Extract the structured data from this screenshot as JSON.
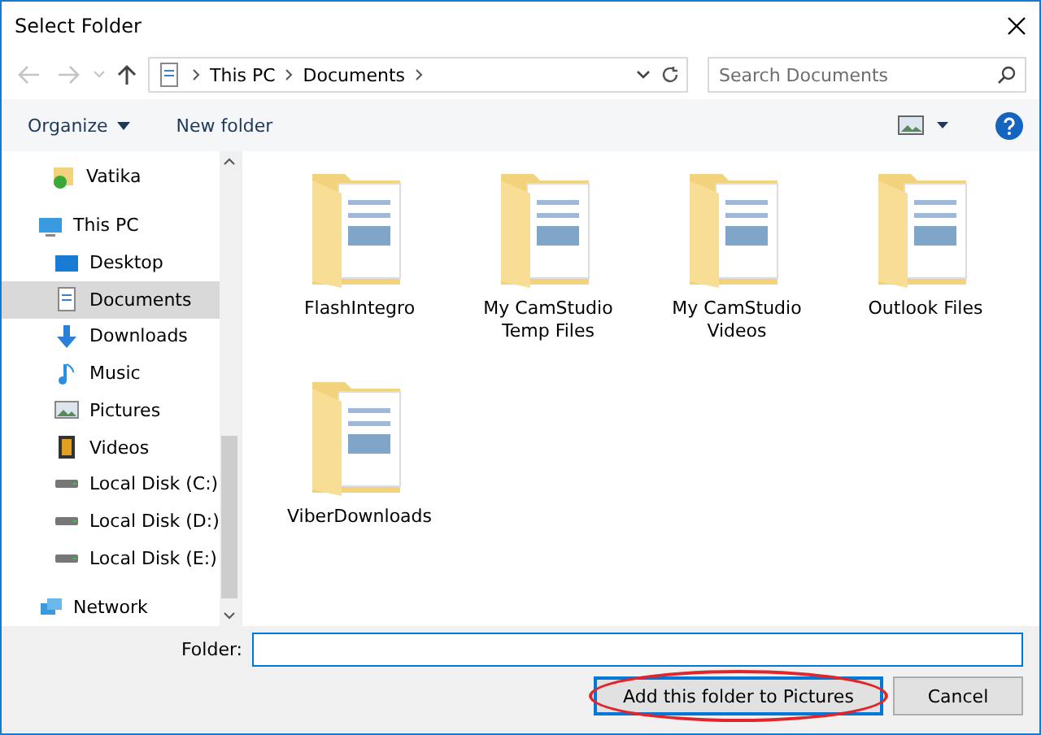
{
  "window": {
    "title": "Select Folder"
  },
  "navigation": {
    "back_disabled": true,
    "forward_disabled": true,
    "path": [
      "This PC",
      "Documents"
    ],
    "search": {
      "placeholder": "Search Documents"
    }
  },
  "toolbar": {
    "buttons": [
      "Organize",
      "New folder"
    ]
  },
  "sidebar": {
    "items": [
      {
        "label": "Vatika",
        "kind": "user",
        "selected": false
      },
      {
        "label": "This PC",
        "kind": "pc",
        "selected": false,
        "children": [
          {
            "label": "Desktop",
            "kind": "desktop",
            "selected": false
          },
          {
            "label": "Documents",
            "kind": "documents",
            "selected": true
          },
          {
            "label": "Downloads",
            "kind": "downloads",
            "selected": false
          },
          {
            "label": "Music",
            "kind": "music",
            "selected": false
          },
          {
            "label": "Pictures",
            "kind": "pictures",
            "selected": false
          },
          {
            "label": "Videos",
            "kind": "videos",
            "selected": false
          },
          {
            "label": "Local Disk (C:)",
            "kind": "disk",
            "selected": false
          },
          {
            "label": "Local Disk (D:)",
            "kind": "disk",
            "selected": false
          },
          {
            "label": "Local Disk (E:)",
            "kind": "disk",
            "selected": false
          }
        ]
      },
      {
        "label": "Network",
        "kind": "network",
        "selected": false
      }
    ]
  },
  "folders": [
    {
      "name": "FlashIntegro"
    },
    {
      "name": "My CamStudio Temp Files"
    },
    {
      "name": "My CamStudio Videos"
    },
    {
      "name": "Outlook Files"
    },
    {
      "name": "ViberDownloads"
    }
  ],
  "footer": {
    "folder_label": "Folder:",
    "buttons": [
      {
        "label": "Add this folder to Pictures",
        "kind": "primary",
        "highlighted": true
      },
      {
        "label": "Cancel",
        "kind": "normal",
        "highlighted": false
      }
    ]
  }
}
